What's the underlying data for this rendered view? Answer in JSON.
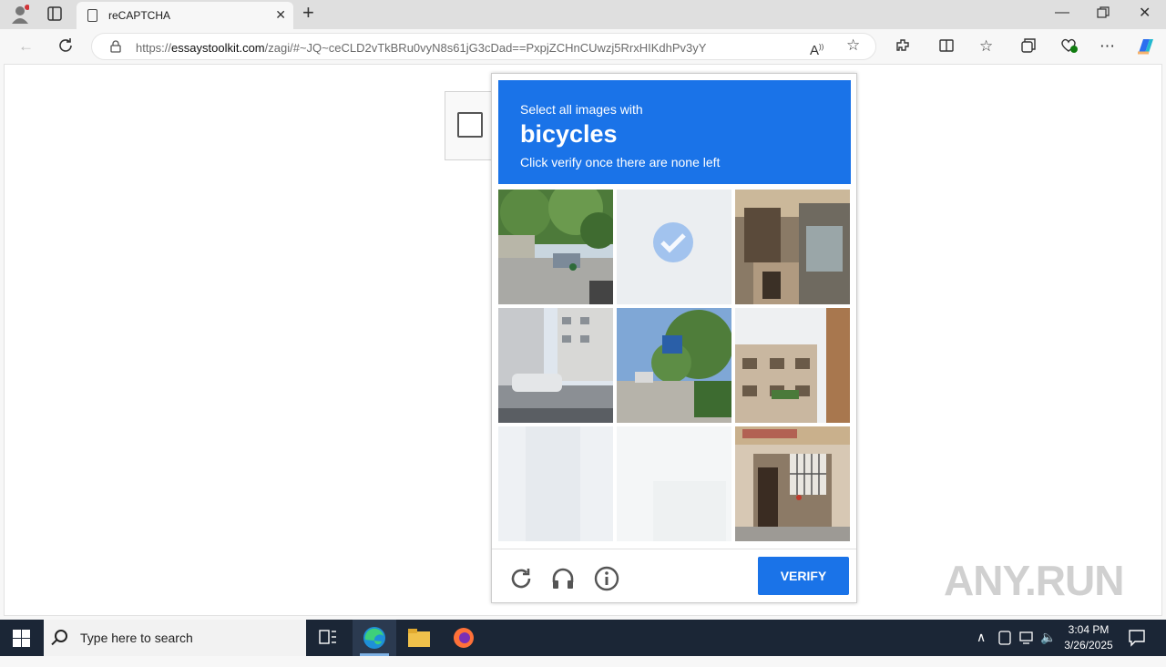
{
  "browser": {
    "tab_title": "reCAPTCHA",
    "url_prefix": "https://",
    "url_domain": "essaystoolkit.com",
    "url_path": "/zagi/#~JQ~ceCLD2vTkBRu0vyN8s61jG3cDad==PxpjZCHnCUwzj5RrxHIKdhPv3yY"
  },
  "captcha": {
    "line1": "Select all images with",
    "target": "bicycles",
    "line3": "Click verify once there are none left",
    "verify_label": "VERIFY",
    "tiles": [
      {
        "id": 1,
        "state": "image",
        "scene": "street-trees"
      },
      {
        "id": 2,
        "state": "selected",
        "scene": "faded"
      },
      {
        "id": 3,
        "state": "image",
        "scene": "market-stall"
      },
      {
        "id": 4,
        "state": "image",
        "scene": "apartments-car"
      },
      {
        "id": 5,
        "state": "image",
        "scene": "street-sign-tree"
      },
      {
        "id": 6,
        "state": "image",
        "scene": "building-facade"
      },
      {
        "id": 7,
        "state": "faded",
        "scene": "blank"
      },
      {
        "id": 8,
        "state": "faded",
        "scene": "blank"
      },
      {
        "id": 9,
        "state": "image",
        "scene": "doorway-grille"
      }
    ],
    "controls": [
      "reload-icon",
      "audio-icon",
      "info-icon"
    ]
  },
  "watermark": "ANY.RUN",
  "taskbar": {
    "search_placeholder": "Type here to search",
    "time": "3:04 PM",
    "date": "3/26/2025"
  },
  "colors": {
    "accent": "#1a73e8",
    "taskbar": "#1b2636"
  }
}
